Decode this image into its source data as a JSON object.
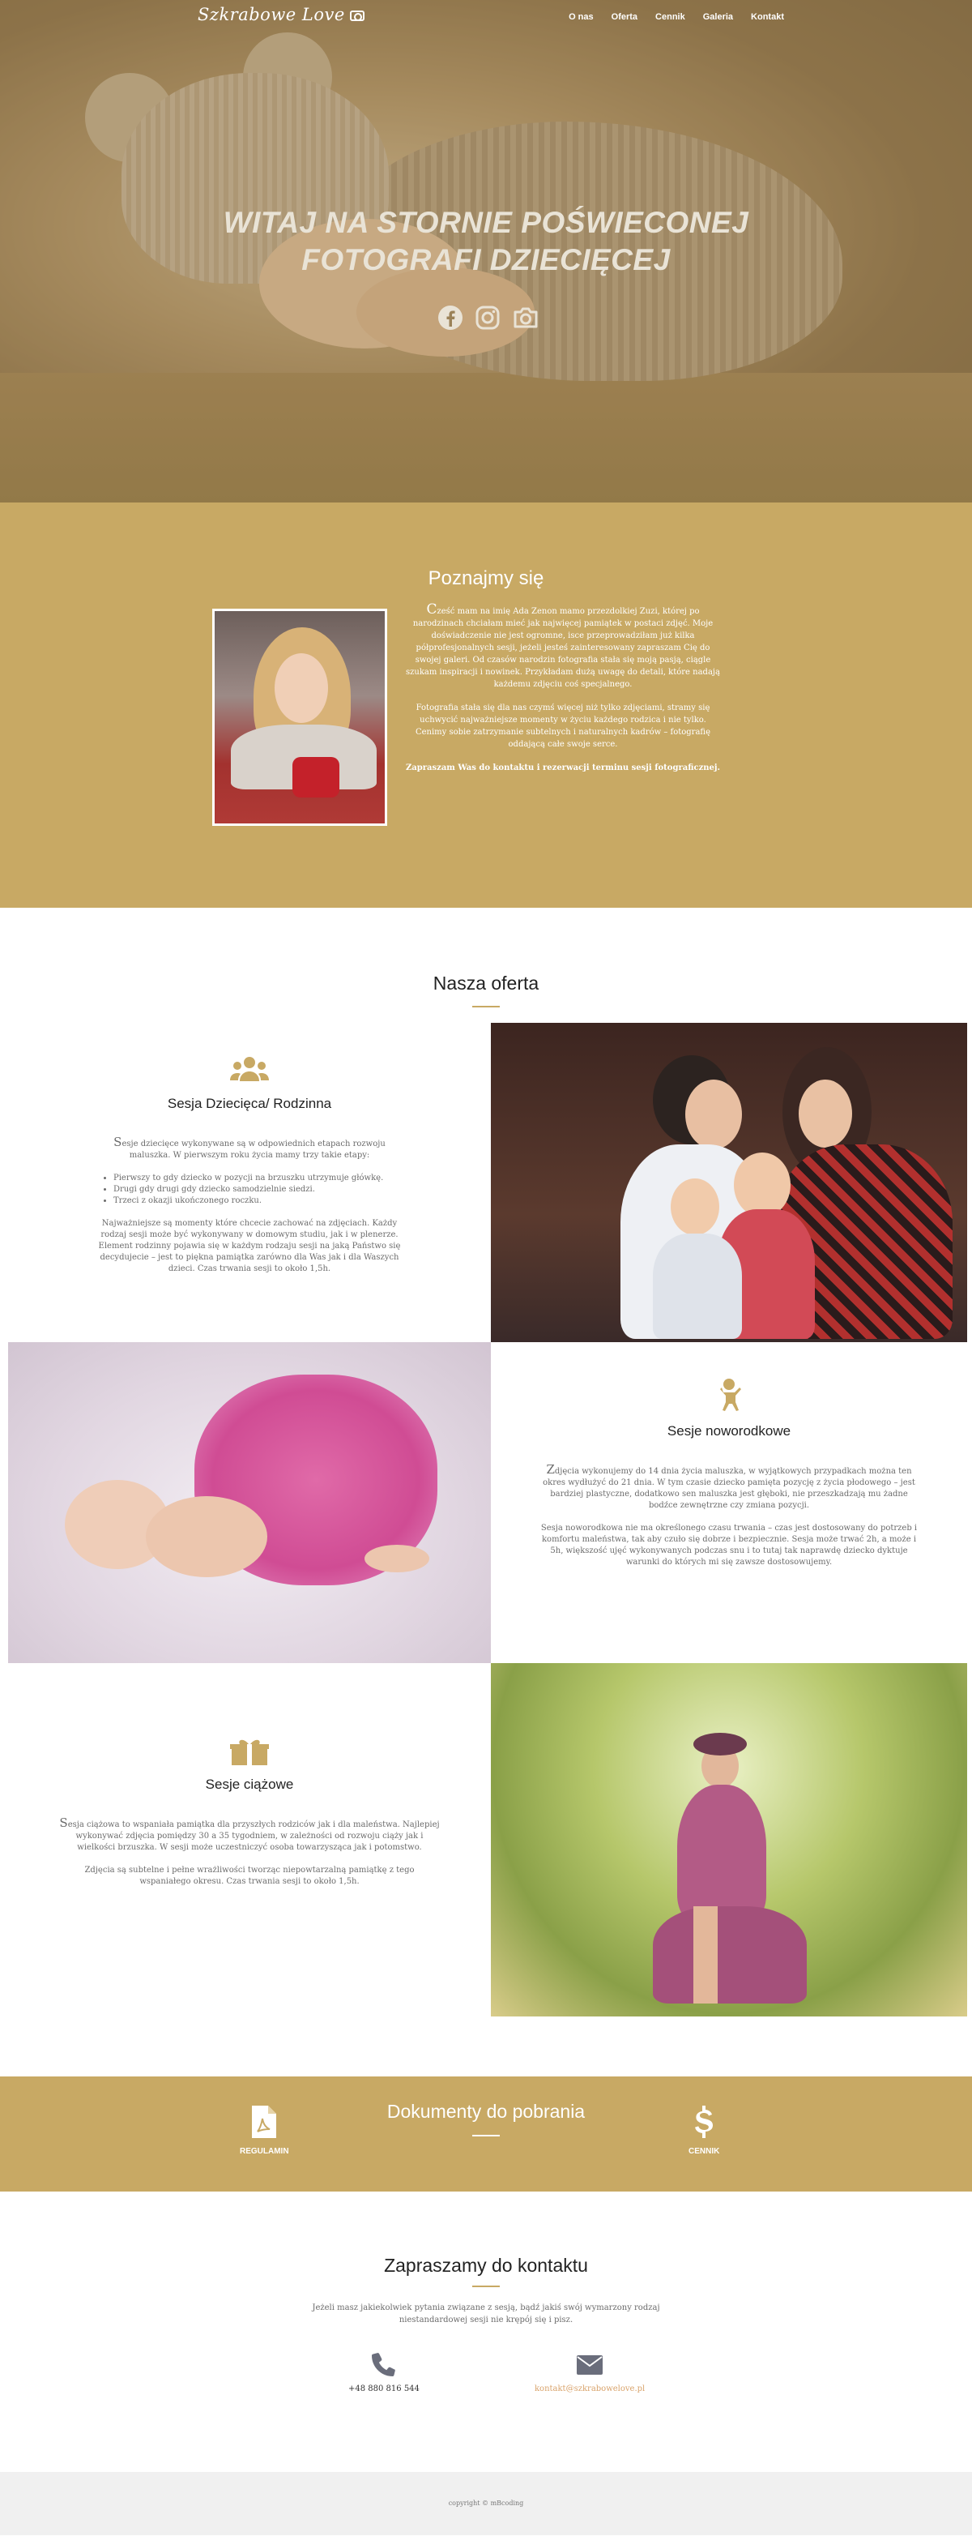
{
  "nav": {
    "logo": "Szkrabowe Love",
    "items": [
      {
        "label": "O nas"
      },
      {
        "label": "Oferta"
      },
      {
        "label": "Cennik"
      },
      {
        "label": "Galeria"
      },
      {
        "label": "Kontakt"
      }
    ]
  },
  "hero": {
    "title_line1": "WITAJ NA STORNIE POŚWIECONEJ",
    "title_line2": "FOTOGRAFI DZIECIĘCEJ",
    "social": [
      "facebook-icon",
      "instagram-icon",
      "camera-icon"
    ]
  },
  "about": {
    "heading": "Poznajmy się",
    "p1_cap": "C",
    "p1": "ześć mam na imię Ada Zenon mamo przezdolkiej Zuzi, której po narodzinach chciałam mieć jak najwięcej pamiątek w postaci zdjęć. Moje doświadczenie nie jest ogromne, isce przeprowadziłam już kilka półprofesjonalnych sesji, jeżeli jesteś zainteresowany zapraszam Cię do swojej galeri. Od czasów narodzin fotografia stała się moją pasją, ciągle szukam inspiracji i nowinek. Przykładam dużą uwagę do detali, które nadają każdemu zdjęciu coś specjalnego.",
    "p2": "Fotografia stała się dla nas czymś więcej niż tylko zdjęciami, stramy się uchwycić najważniejsze momenty w życiu każdego rodzica i nie tylko. Cenimy sobie zatrzymanie subtelnych i naturalnych kadrów – fotografię oddającą całe swoje serce.",
    "p3": "Zapraszam Was do kontaktu i rezerwacji terminu sesji fotograficznej."
  },
  "offer": {
    "heading": "Nasza oferta",
    "cards": [
      {
        "title": "Sesja Dziecięca/ Rodzinna",
        "icon": "users-icon",
        "intro_cap": "S",
        "intro": "esje dziecięce wykonywane są w odpowiednich etapach rozwoju maluszka. W pierwszym roku życia mamy trzy takie etapy:",
        "list": [
          "Pierwszy to gdy dziecko w pozycji na brzuszku utrzymuje główkę.",
          "Drugi gdy drugi gdy dziecko samodzielnie siedzi.",
          "Trzeci z okazji ukończonego roczku."
        ],
        "outro": "Najważniejsze są momenty które chcecie zachować na zdjęciach. Każdy rodzaj sesji może być wykonywany w domowym studiu, jak i w plenerze. Element rodzinny pojawia się w każdym rodzaju sesji na jaką Państwo się decydujecie – jest to piękna pamiątka zarówno dla Was jak i dla Waszych dzieci. Czas trwania sesji to około 1,5h."
      },
      {
        "title": "Sesje noworodkowe",
        "icon": "baby-icon",
        "intro_cap": "Z",
        "intro": "djęcia wykonujemy do 14 dnia życia maluszka, w wyjątkowych przypadkach można ten okres wydłużyć do 21 dnia. W tym czasie dziecko pamięta pozycję z życia płodowego – jest bardziej plastyczne, dodatkowo sen maluszka jest głęboki, nie przeszkadzają mu żadne bodźce zewnętrzne czy zmiana pozycji.",
        "outro": "Sesja noworodkowa nie ma określonego czasu trwania – czas jest dostosowany do potrzeb i komfortu maleństwa, tak aby czuło się dobrze i bezpiecznie. Sesja może trwać 2h, a może i 5h, większość ujęć wykonywanych podczas snu i to tutaj tak naprawdę dziecko dyktuje warunki do których mi się zawsze dostosowujemy."
      },
      {
        "title": "Sesje ciążowe",
        "icon": "gift-icon",
        "intro_cap": "S",
        "intro": "esja ciążowa to wspaniała pamiątka dla przyszłych rodziców jak i dla maleństwa. Najlepiej wykonywać zdjęcia pomiędzy 30 a 35 tygodniem, w zależności od rozwoju ciąży jak i wielkości brzuszka. W sesji może uczestniczyć osoba towarzysząca jak i potomstwo.",
        "outro": "Zdjęcia są subtelne i pełne wrażliwości tworząc niepowtarzalną pamiątkę z tego wspaniałego okresu. Czas trwania sesji to około 1,5h."
      }
    ]
  },
  "docs": {
    "heading": "Dokumenty do pobrania",
    "items": [
      {
        "label": "REGULAMIN",
        "icon": "pdf-icon"
      },
      {
        "label": "CENNIK",
        "icon": "dollar-icon"
      }
    ]
  },
  "contact": {
    "heading": "Zapraszamy do kontaktu",
    "intro": "Jeżeli masz jakiekolwiek pytania związane z sesją, bądź jakiś swój wymarzony rodzaj niestandardowej sesji nie krępój się i pisz.",
    "phone": "+48 880 816 544",
    "email": "kontakt@szkrabowelove.pl"
  },
  "footer": {
    "text": "copyright © mBcoding"
  },
  "colors": {
    "accent": "#c8a964",
    "link": "#d9a36b"
  }
}
